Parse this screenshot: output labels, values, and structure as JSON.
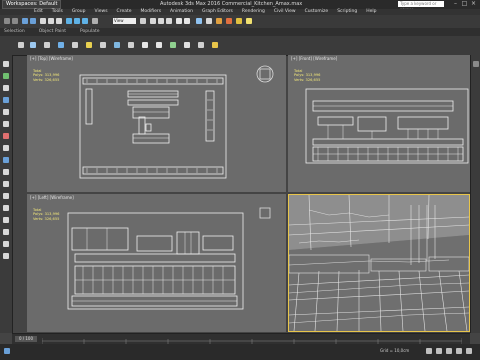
{
  "titlebar": {
    "workspace": "Workspaces: Default",
    "title": "Autodesk 3ds Max 2016   Commercial_Kitchen_Amax.max",
    "search_placeholder": "Type a keyword or phrase"
  },
  "menu": [
    "Edit",
    "Tools",
    "Group",
    "Views",
    "Create",
    "Modifiers",
    "Animation",
    "Graph Editors",
    "Rendering",
    "Civil View",
    "Customize",
    "Scripting",
    "Help"
  ],
  "toolbar": {
    "select_value": "View"
  },
  "ribbon": [
    "Selection",
    "Object Paint",
    "Populate"
  ],
  "viewports": [
    {
      "label": "[+] [Top] [Wireframe]",
      "stats": {
        "header": "Total",
        "polys_label": "Polys:",
        "polys": "313,996",
        "verts_label": "Verts:",
        "verts": "326,655"
      }
    },
    {
      "label": "[+] [Front] [Wireframe]",
      "stats": {
        "header": "Total",
        "polys_label": "Polys:",
        "polys": "313,996",
        "verts_label": "Verts:",
        "verts": "326,655"
      }
    },
    {
      "label": "[+] [Left] [Wireframe]",
      "stats": {
        "header": "Total",
        "polys_label": "Polys:",
        "polys": "313,996",
        "verts_label": "Verts:",
        "verts": "326,655"
      }
    },
    {
      "label": "",
      "stats": null
    }
  ],
  "timeline": {
    "frame": "0 / 100"
  },
  "status": {
    "grid": "Grid = 10,0cm"
  },
  "colors": {
    "active_border": "#e8c54a",
    "stats_text": "#f2e77a",
    "viewport_bg": "#6b6b6b"
  }
}
